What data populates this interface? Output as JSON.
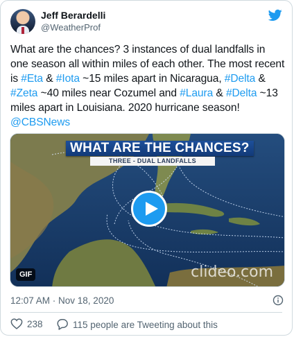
{
  "author": {
    "display_name": "Jeff Berardelli",
    "handle": "@WeatherProf"
  },
  "tweet": {
    "segments": [
      {
        "text": "What are the chances? 3 instances of dual landfalls in one season all within miles of each other. The most recent is ",
        "link": false
      },
      {
        "text": "#Eta",
        "link": true
      },
      {
        "text": " & ",
        "link": false
      },
      {
        "text": "#Iota",
        "link": true
      },
      {
        "text": " ~15 miles apart in Nicaragua, ",
        "link": false
      },
      {
        "text": "#Delta",
        "link": true
      },
      {
        "text": " & ",
        "link": false
      },
      {
        "text": "#Zeta",
        "link": true
      },
      {
        "text": " ~40 miles near Cozumel and ",
        "link": false
      },
      {
        "text": "#Laura",
        "link": true
      },
      {
        "text": " & ",
        "link": false
      },
      {
        "text": "#Delta",
        "link": true
      },
      {
        "text": " ~13 miles apart in Louisiana. 2020 hurricane season! ",
        "link": false
      },
      {
        "text": "@CBSNews",
        "link": true
      }
    ]
  },
  "media": {
    "banner_title": "WHAT ARE THE CHANCES?",
    "banner_subtitle": "THREE - DUAL LANDFALLS",
    "badge": "GIF",
    "watermark": "clideo.com"
  },
  "meta": {
    "timestamp": "12:07 AM · Nov 18, 2020"
  },
  "actions": {
    "likes": "238",
    "conversation": "115 people are Tweeting about this"
  },
  "icons": [
    "twitter-bird-icon",
    "play-icon",
    "info-icon",
    "heart-icon",
    "comment-icon"
  ],
  "colors": {
    "accent": "#1d9bf0",
    "secondary_text": "#536471",
    "border": "#cfd9de"
  }
}
